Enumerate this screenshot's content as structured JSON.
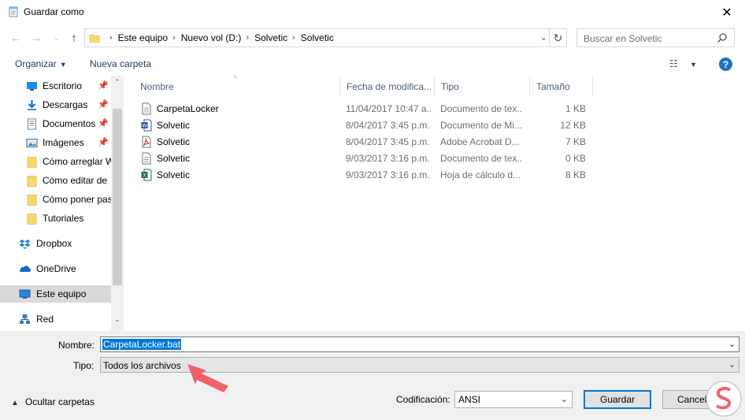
{
  "window": {
    "title": "Guardar como",
    "close_glyph": "✕"
  },
  "nav": {
    "back_icon": "arrow-left-icon",
    "forward_icon": "arrow-right-icon",
    "recent_icon": "chevron-down-icon",
    "up_icon": "arrow-up-icon"
  },
  "address": {
    "crumbs": [
      "Este equipo",
      "Nuevo vol (D:)",
      "Solvetic",
      "Solvetic"
    ]
  },
  "search": {
    "placeholder": "Buscar en Solvetic"
  },
  "toolbar": {
    "organize": "Organizar",
    "new_folder": "Nueva carpeta",
    "help": "?"
  },
  "sidebar": {
    "quick": [
      {
        "label": "Escritorio",
        "icon": "desktop-icon",
        "pinned": true
      },
      {
        "label": "Descargas",
        "icon": "download-icon",
        "pinned": true
      },
      {
        "label": "Documentos",
        "icon": "documents-icon",
        "pinned": true
      },
      {
        "label": "Imágenes",
        "icon": "pictures-icon",
        "pinned": true
      },
      {
        "label": "Cómo arreglar W",
        "icon": "folder-icon",
        "pinned": false
      },
      {
        "label": "Cómo editar de ",
        "icon": "folder-icon",
        "pinned": false
      },
      {
        "label": "Cómo poner pas",
        "icon": "folder-icon",
        "pinned": false
      },
      {
        "label": "Tutoriales",
        "icon": "folder-icon",
        "pinned": false
      }
    ],
    "sections": [
      {
        "label": "Dropbox",
        "icon": "dropbox-icon",
        "selected": false
      },
      {
        "label": "OneDrive",
        "icon": "onedrive-icon",
        "selected": false
      },
      {
        "label": "Este equipo",
        "icon": "computer-icon",
        "selected": true
      },
      {
        "label": "Red",
        "icon": "network-icon",
        "selected": false
      }
    ]
  },
  "columns": [
    "Nombre",
    "Fecha de modifica...",
    "Tipo",
    "Tamaño"
  ],
  "files": [
    {
      "name": "CarpetaLocker",
      "date": "11/04/2017 10:47 a...",
      "type": "Documento de tex...",
      "size": "1 KB",
      "icon": "text-file-icon"
    },
    {
      "name": "Solvetic",
      "date": "8/04/2017 3:45 p.m.",
      "type": "Documento de Mi...",
      "size": "12 KB",
      "icon": "word-file-icon"
    },
    {
      "name": "Solvetic",
      "date": "8/04/2017 3:45 p.m.",
      "type": "Adobe Acrobat D...",
      "size": "7 KB",
      "icon": "pdf-file-icon"
    },
    {
      "name": "Solvetic",
      "date": "9/03/2017 3:16 p.m.",
      "type": "Documento de tex...",
      "size": "0 KB",
      "icon": "text-file-icon"
    },
    {
      "name": "Solvetic",
      "date": "9/03/2017 3:16 p.m.",
      "type": "Hoja de cálculo d...",
      "size": "8 KB",
      "icon": "excel-file-icon"
    }
  ],
  "form": {
    "name_label": "Nombre:",
    "name_value": "CarpetaLocker.bat",
    "type_label": "Tipo:",
    "type_value": "Todos los archivos",
    "hide_folders": "Ocultar carpetas",
    "encoding_label": "Codificación:",
    "encoding_value": "ANSI",
    "save": "Guardar",
    "cancel": "Cancelar"
  },
  "colors": {
    "accent": "#0078d7",
    "link": "#1e3f66",
    "annotation_arrow": "#f0606a"
  }
}
